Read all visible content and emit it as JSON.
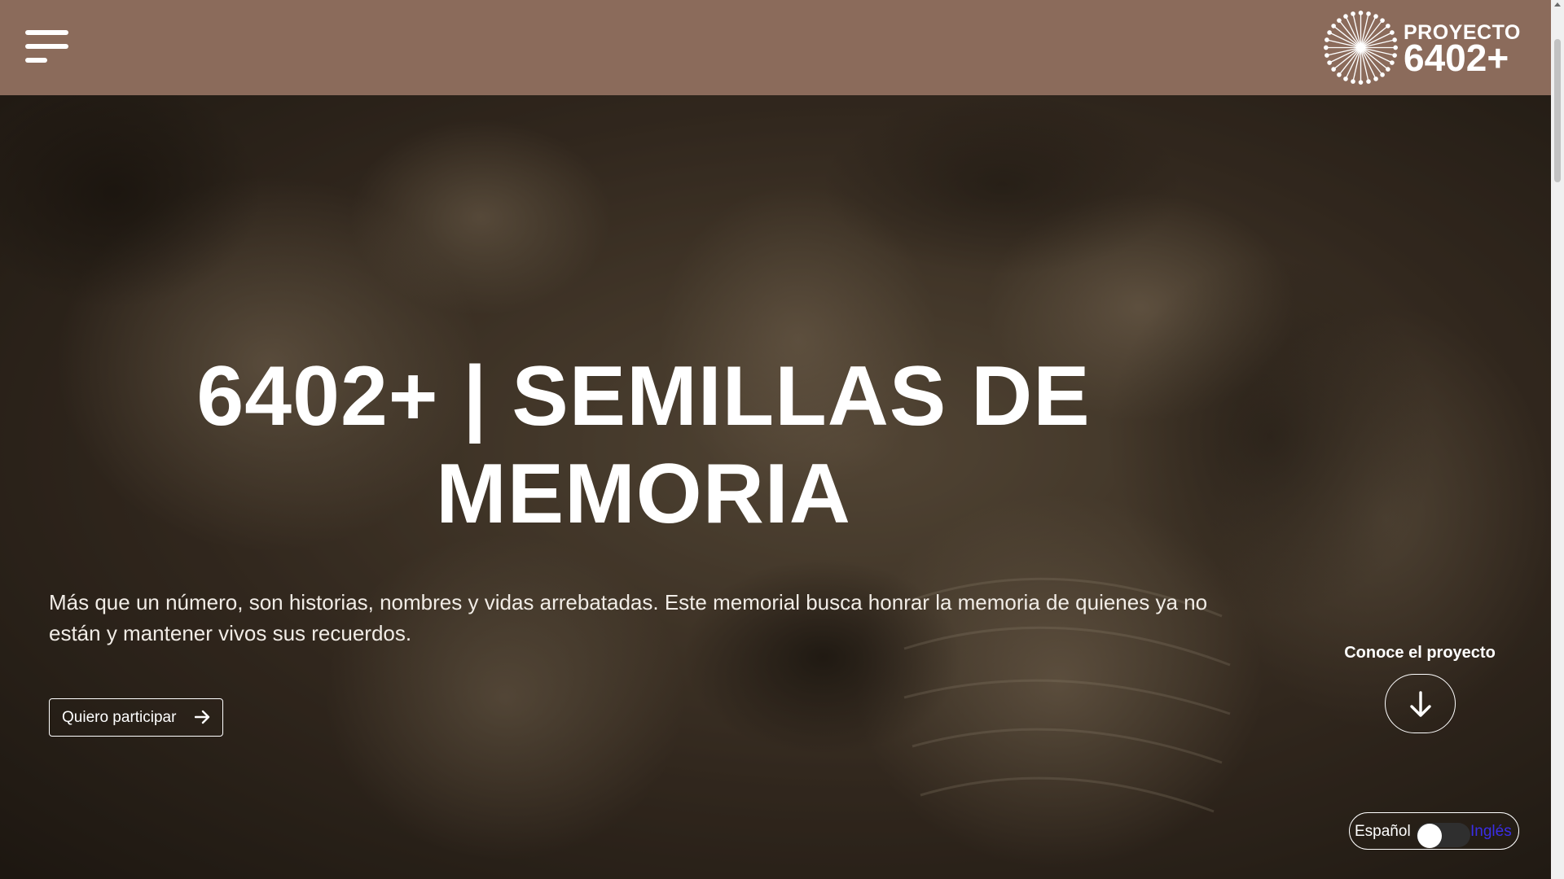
{
  "header": {
    "menu_icon": "hamburger-menu-icon",
    "logo": {
      "line1": "PROYECTO",
      "line2": "6402+",
      "mark_icon": "dandelion-icon"
    }
  },
  "hero": {
    "title": "6402+ | SEMILLAS DE MEMORIA",
    "description": "Más que un número, son historias, nombres y vidas arrebatadas. Este memorial busca honrar la memoria de quienes ya no están y mantener vivos sus recuerdos.",
    "cta_label": "Quiero participar",
    "cta_icon": "arrow-right-icon",
    "know_label": "Conoce el proyecto",
    "know_icon": "arrow-down-icon"
  },
  "language": {
    "left_label": "Español",
    "right_label": "Inglés",
    "selected": "Español"
  },
  "colors": {
    "header_bg": "#8b6b5b",
    "text": "#ffffff",
    "link_accent": "#3a2ee6"
  }
}
